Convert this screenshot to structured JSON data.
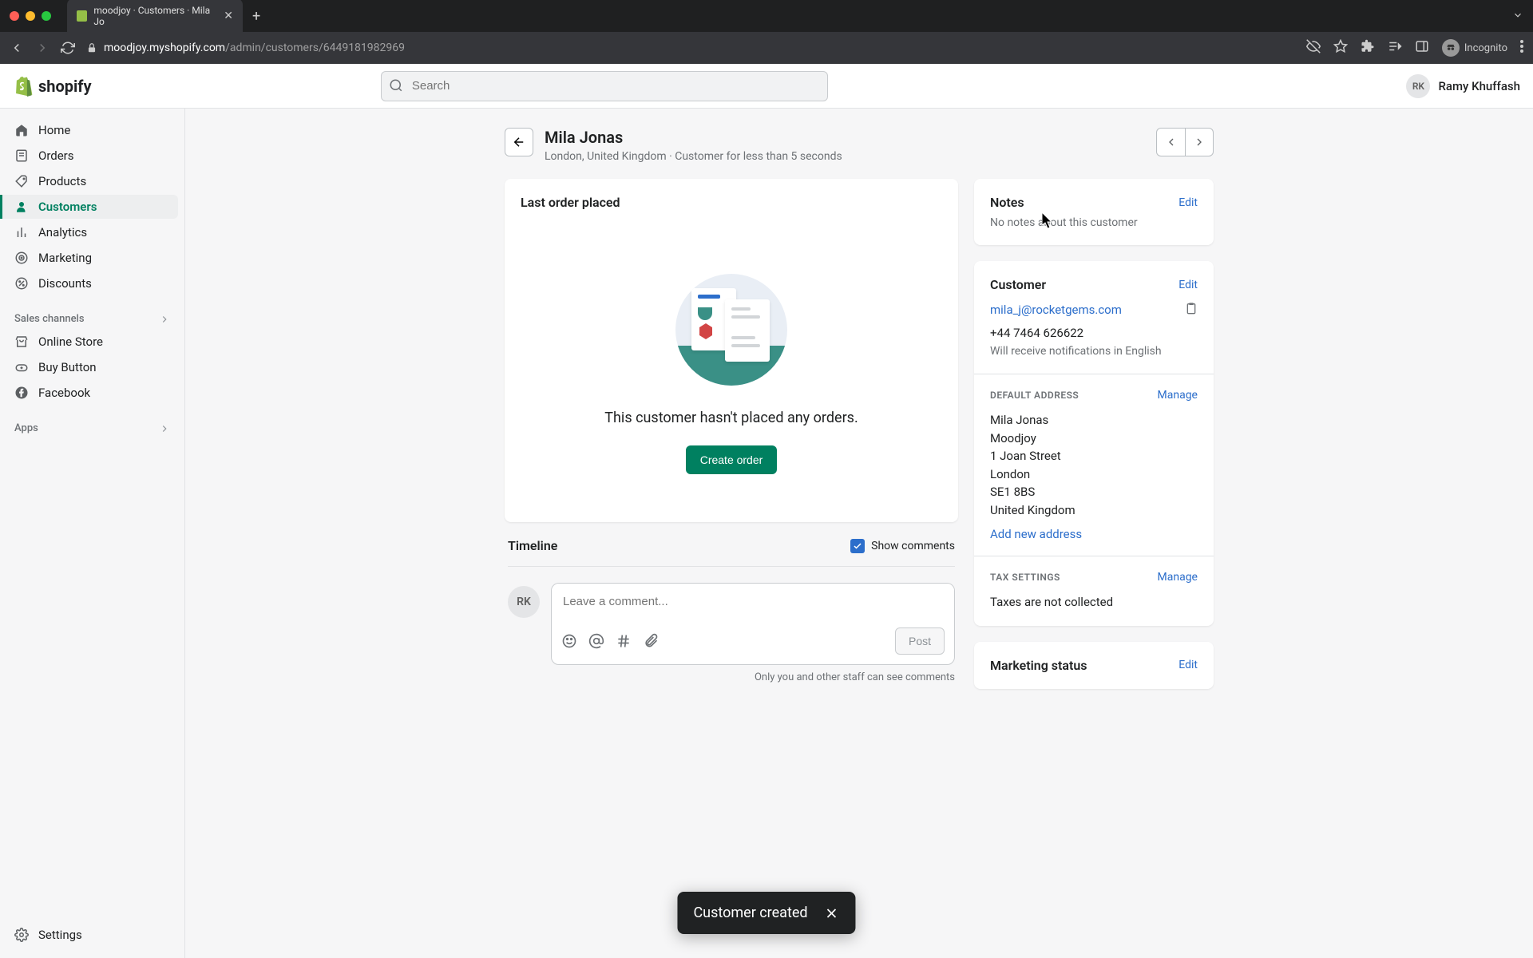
{
  "browser": {
    "tab_title": "moodjoy · Customers · Mila Jo",
    "url_host": "moodjoy.myshopify.com",
    "url_path": "/admin/customers/6449181982969",
    "incognito": "Incognito"
  },
  "topbar": {
    "logo_text": "shopify",
    "search_placeholder": "Search",
    "user_initials": "RK",
    "user_name": "Ramy Khuffash"
  },
  "sidebar": {
    "items": [
      {
        "label": "Home"
      },
      {
        "label": "Orders"
      },
      {
        "label": "Products"
      },
      {
        "label": "Customers"
      },
      {
        "label": "Analytics"
      },
      {
        "label": "Marketing"
      },
      {
        "label": "Discounts"
      }
    ],
    "section_sales": "Sales channels",
    "channels": [
      {
        "label": "Online Store"
      },
      {
        "label": "Buy Button"
      },
      {
        "label": "Facebook"
      }
    ],
    "section_apps": "Apps",
    "settings": "Settings"
  },
  "header": {
    "title": "Mila Jonas",
    "subtitle": "London, United Kingdom · Customer for less than 5 seconds"
  },
  "orders_card": {
    "title": "Last order placed",
    "empty_msg": "This customer hasn't placed any orders.",
    "create_btn": "Create order"
  },
  "timeline": {
    "title": "Timeline",
    "show_comments": "Show comments",
    "avatar": "RK",
    "placeholder": "Leave a comment...",
    "post_btn": "Post",
    "note": "Only you and other staff can see comments"
  },
  "notes": {
    "title": "Notes",
    "edit": "Edit",
    "empty": "No notes about this customer"
  },
  "customer": {
    "title": "Customer",
    "edit": "Edit",
    "email": "mila_j@rocketgems.com",
    "phone": "+44 7464 626622",
    "lang": "Will receive notifications in English",
    "addr_title": "DEFAULT ADDRESS",
    "manage": "Manage",
    "addr": {
      "name": "Mila Jonas",
      "company": "Moodjoy",
      "street": "1 Joan Street",
      "city": "London",
      "zip": "SE1 8BS",
      "country": "United Kingdom"
    },
    "add_addr": "Add new address",
    "tax_title": "TAX SETTINGS",
    "tax_status": "Taxes are not collected"
  },
  "marketing": {
    "title": "Marketing status",
    "edit": "Edit"
  },
  "toast": {
    "msg": "Customer created"
  }
}
